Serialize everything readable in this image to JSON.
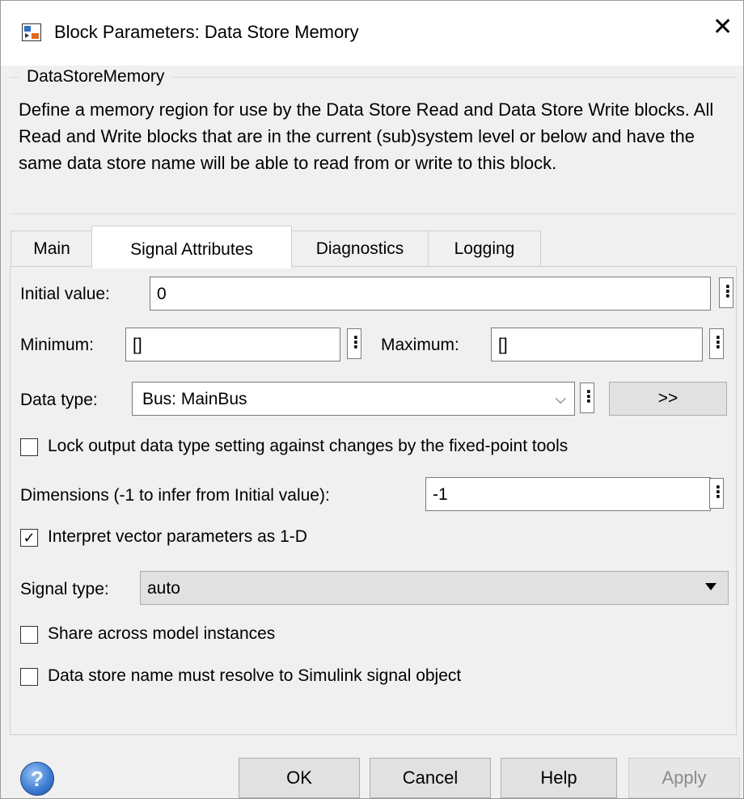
{
  "window": {
    "title": "Block Parameters: Data Store Memory",
    "close_glyph": "✕"
  },
  "group": {
    "label": "DataStoreMemory",
    "description": "Define a memory region for use by the Data Store Read and Data Store Write blocks. All Read and Write blocks that are in the current (sub)system level or below and have the same data store name will be able to read from or write to this block."
  },
  "tabs": [
    {
      "label": "Main",
      "active": false
    },
    {
      "label": "Signal Attributes",
      "active": true
    },
    {
      "label": "Diagnostics",
      "active": false
    },
    {
      "label": "Logging",
      "active": false
    }
  ],
  "form": {
    "initial_value": {
      "label": "Initial value:",
      "value": "0"
    },
    "minimum": {
      "label": "Minimum:",
      "value": "[]"
    },
    "maximum": {
      "label": "Maximum:",
      "value": "[]"
    },
    "data_type": {
      "label": "Data type:",
      "value": "Bus: MainBus",
      "more_button": ">>"
    },
    "lock_output": {
      "label": "Lock output data type setting against changes by the fixed-point tools",
      "checked": false
    },
    "dimensions": {
      "label": "Dimensions (-1 to infer from Initial value):",
      "value": "-1"
    },
    "interpret_vector": {
      "label": "Interpret vector parameters as 1-D",
      "checked": true
    },
    "signal_type": {
      "label": "Signal type:",
      "value": "auto"
    },
    "share_instances": {
      "label": "Share across model instances",
      "checked": false
    },
    "resolve_simulink": {
      "label": "Data store name must resolve to Simulink signal object",
      "checked": false
    }
  },
  "footer": {
    "help_icon_glyph": "?",
    "ok": "OK",
    "cancel": "Cancel",
    "help": "Help",
    "apply": "Apply",
    "apply_disabled": true
  },
  "glyphs": {
    "kebab": "⋮",
    "check": "✓",
    "chevron": "⌵"
  },
  "colors": {
    "background": "#f0f0f0",
    "titlebar": "#ffffff",
    "border": "#7a7a7a"
  }
}
